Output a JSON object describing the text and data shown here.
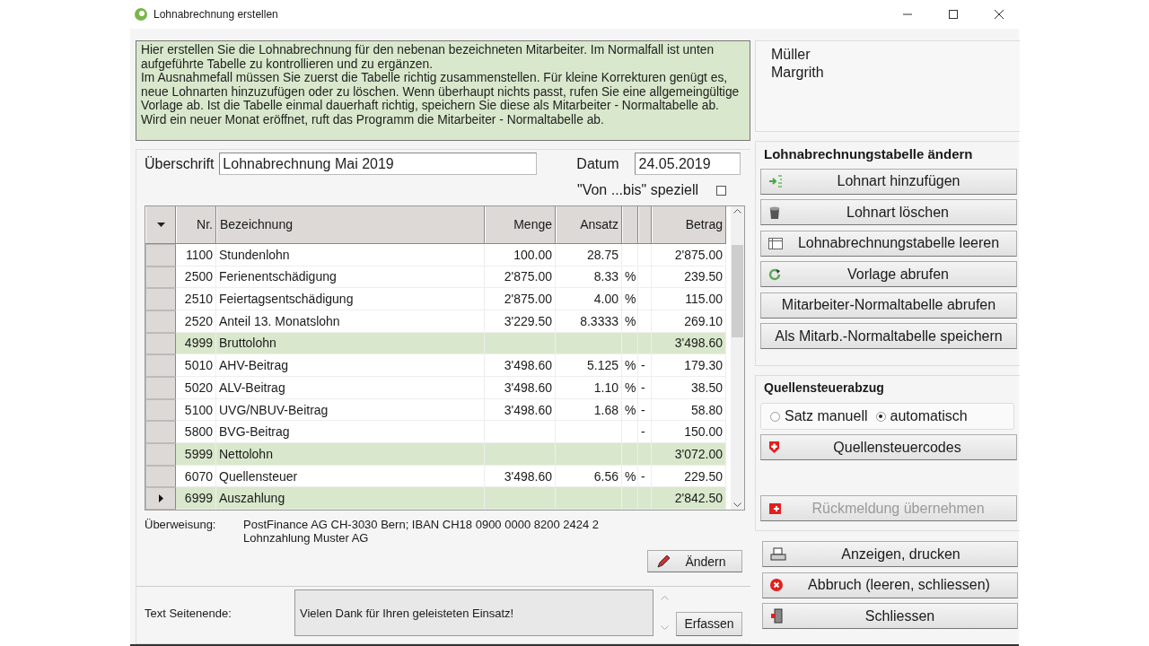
{
  "window": {
    "title": "Lohnabrechnung erstellen"
  },
  "info_text": "Hier erstellen Sie die Lohnabrechnung für den nebenan bezeichneten Mitarbeiter. Im Normalfall ist unten aufgeführte Tabelle zu kontrollieren und zu ergänzen.\nIm Ausnahmefall müssen Sie zuerst die Tabelle richtig zusammenstellen. Für kleine Korrekturen genügt es, neue Lohnarten hinzuzufügen oder zu löschen. Wenn überhaupt nichts passt, rufen Sie eine allgemeingültige Vorlage ab. Ist die Tabelle einmal dauerhaft richtig, speichern Sie diese als Mitarbeiter - Normaltabelle ab. Wird ein neuer Monat eröffnet, ruft das Programm die Mitarbeiter - Normaltabelle ab.",
  "employee": [
    "Müller",
    "Margrith"
  ],
  "heading": {
    "label": "Überschrift",
    "value": "Lohnabrechnung Mai 2019"
  },
  "date": {
    "label": "Datum",
    "value": "24.05.2019"
  },
  "special_range": {
    "label": "\"Von ...bis\" speziell",
    "checked": false
  },
  "table": {
    "columns": [
      "Nr.",
      "Bezeichnung",
      "Menge",
      "Ansatz",
      "Betrag"
    ],
    "rows": [
      {
        "kind": "item",
        "current": false,
        "nr": "1100",
        "name": "Stundenlohn",
        "menge": "100.00",
        "ansatz": "28.75",
        "unit": "",
        "sign": "",
        "betrag": "2'875.00"
      },
      {
        "kind": "item",
        "current": false,
        "nr": "2500",
        "name": "Ferienentschädigung",
        "menge": "2'875.00",
        "ansatz": "8.33",
        "unit": "%",
        "sign": "",
        "betrag": "239.50"
      },
      {
        "kind": "item",
        "current": false,
        "nr": "2510",
        "name": "Feiertagsentschädigung",
        "menge": "2'875.00",
        "ansatz": "4.00",
        "unit": "%",
        "sign": "",
        "betrag": "115.00"
      },
      {
        "kind": "item",
        "current": false,
        "nr": "2520",
        "name": "Anteil 13. Monatslohn",
        "menge": "3'229.50",
        "ansatz": "8.3333",
        "unit": "%",
        "sign": "",
        "betrag": "269.10"
      },
      {
        "kind": "total",
        "current": false,
        "nr": "4999",
        "name": "Bruttolohn",
        "menge": "",
        "ansatz": "",
        "unit": "",
        "sign": "",
        "betrag": "3'498.60"
      },
      {
        "kind": "item",
        "current": false,
        "nr": "5010",
        "name": "AHV-Beitrag",
        "menge": "3'498.60",
        "ansatz": "5.125",
        "unit": "%",
        "sign": "-",
        "betrag": "179.30"
      },
      {
        "kind": "item",
        "current": false,
        "nr": "5020",
        "name": "ALV-Beitrag",
        "menge": "3'498.60",
        "ansatz": "1.10",
        "unit": "%",
        "sign": "-",
        "betrag": "38.50"
      },
      {
        "kind": "item",
        "current": false,
        "nr": "5100",
        "name": "UVG/NBUV-Beitrag",
        "menge": "3'498.60",
        "ansatz": "1.68",
        "unit": "%",
        "sign": "-",
        "betrag": "58.80"
      },
      {
        "kind": "item",
        "current": false,
        "nr": "5800",
        "name": "BVG-Beitrag",
        "menge": "",
        "ansatz": "",
        "unit": "",
        "sign": "-",
        "betrag": "150.00"
      },
      {
        "kind": "total",
        "current": false,
        "nr": "5999",
        "name": "Nettolohn",
        "menge": "",
        "ansatz": "",
        "unit": "",
        "sign": "",
        "betrag": "3'072.00"
      },
      {
        "kind": "item",
        "current": false,
        "nr": "6070",
        "name": "Quellensteuer",
        "menge": "3'498.60",
        "ansatz": "6.56",
        "unit": "%",
        "sign": "-",
        "betrag": "229.50"
      },
      {
        "kind": "total",
        "current": true,
        "nr": "6999",
        "name": "Auszahlung",
        "menge": "",
        "ansatz": "",
        "unit": "",
        "sign": "",
        "betrag": "2'842.50"
      }
    ]
  },
  "transfer": {
    "label": "Überweisung:",
    "lines": [
      "PostFinance AG CH-3030 Bern; IBAN CH18 0900 0000 8200 2424 2",
      "Lohnzahlung Muster AG"
    ],
    "button": "Ändern"
  },
  "footer_text": {
    "label": "Text Seitenende:",
    "value": "Vielen Dank für Ihren geleisteten Einsatz!",
    "button": "Erfassen"
  },
  "table_actions": {
    "title": "Lohnabrechnungstabelle ändern",
    "buttons": [
      {
        "kind": "add",
        "label": "Lohnart hinzufügen"
      },
      {
        "kind": "delete",
        "label": "Lohnart löschen"
      },
      {
        "kind": "clear",
        "label": "Lohnabrechnungstabelle leeren"
      },
      {
        "kind": "template",
        "label": "Vorlage abrufen"
      },
      {
        "kind": "plain",
        "label": "Mitarbeiter-Normaltabelle abrufen"
      },
      {
        "kind": "plain",
        "label": "Als Mitarb.-Normaltabelle speichern"
      }
    ]
  },
  "withholding": {
    "title": "Quellensteuerabzug",
    "options": [
      {
        "label": "Satz manuell",
        "selected": false
      },
      {
        "label": "automatisch",
        "selected": true
      }
    ],
    "buttons": [
      {
        "kind": "codes",
        "label": "Quellensteuercodes",
        "disabled": false
      },
      {
        "kind": "feedback",
        "label": "Rückmeldung übernehmen",
        "disabled": true
      }
    ]
  },
  "actions": [
    {
      "kind": "print",
      "label": "Anzeigen, drucken"
    },
    {
      "kind": "cancel",
      "label": "Abbruch (leeren, schliessen)"
    },
    {
      "kind": "exit",
      "label": "Schliessen"
    }
  ]
}
